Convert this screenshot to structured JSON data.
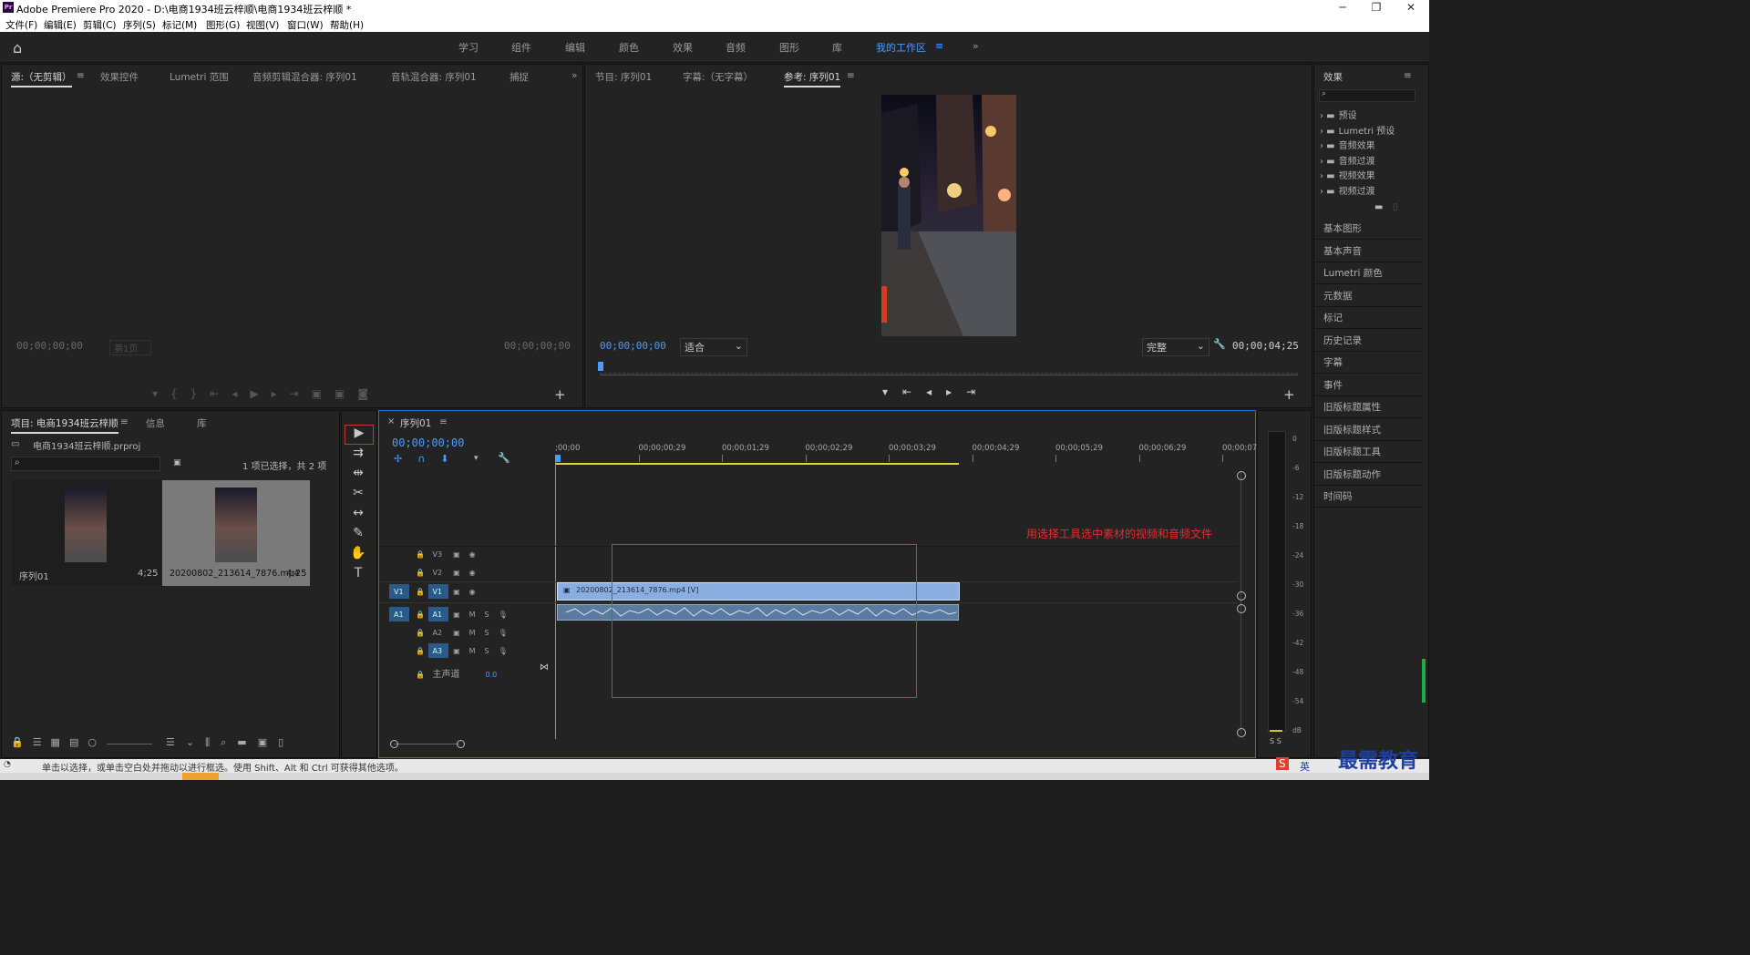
{
  "app": {
    "title": "Adobe Premiere Pro 2020 - D:\\电商1934班云梓顺\\电商1934班云梓顺 *"
  },
  "menu": [
    "文件(F)",
    "编辑(E)",
    "剪辑(C)",
    "序列(S)",
    "标记(M)",
    "图形(G)",
    "视图(V)",
    "窗口(W)",
    "帮助(H)"
  ],
  "workspaces": [
    "学习",
    "组件",
    "编辑",
    "颜色",
    "效果",
    "音频",
    "图形",
    "库",
    "我的工作区"
  ],
  "source_panel": {
    "tabs": [
      "源:（无剪辑）",
      "效果控件",
      "Lumetri 范围",
      "音频剪辑混合器: 序列01",
      "音轨混合器: 序列01",
      "捕捉"
    ],
    "tc_left": "00;00;00;00",
    "page": "第1页",
    "tc_right": "00;00;00;00"
  },
  "program_panel": {
    "tabs": [
      "节目: 序列01",
      "字幕:（无字幕）",
      "参考: 序列01"
    ],
    "tc_left": "00;00;00;00",
    "fit": "适合",
    "quality": "完整",
    "tc_right": "00;00;04;25"
  },
  "effects_panel": {
    "title": "效果",
    "folders": [
      "预设",
      "Lumetri 预设",
      "音频效果",
      "音频过渡",
      "视频效果",
      "视频过渡"
    ],
    "items": [
      "基本图形",
      "基本声音",
      "Lumetri 颜色",
      "元数据",
      "标记",
      "历史记录",
      "字幕",
      "事件",
      "旧版标题属性",
      "旧版标题样式",
      "旧版标题工具",
      "旧版标题动作",
      "时间码"
    ]
  },
  "project_panel": {
    "tabs": [
      "项目: 电商1934班云梓顺",
      "信息",
      "库"
    ],
    "file": "电商1934班云梓顺.prproj",
    "selection": "1 项已选择，共 2 项",
    "items": [
      {
        "name": "序列01",
        "dur": "4;25"
      },
      {
        "name": "20200802_213614_7876.mp4",
        "dur": "4;25"
      }
    ]
  },
  "timeline": {
    "tab": "序列01",
    "tc": "00;00;00;00",
    "ruler": [
      ";00;00",
      "00;00;00;29",
      "00;00;01;29",
      "00;00;02;29",
      "00;00;03;29",
      "00;00;04;29",
      "00;00;05;29",
      "00;00;06;29",
      "00;00;07;"
    ],
    "video_tracks": [
      "V3",
      "V2",
      "V1"
    ],
    "audio_tracks": [
      "A1",
      "A2",
      "A3"
    ],
    "master": "主声道",
    "master_val": "0.0",
    "clip_v": "20200802_213614_7876.mp4 [V]",
    "annotation": "用选择工具选中素材的视频和音频文件"
  },
  "meter": {
    "scale": [
      "0",
      "-6",
      "-12",
      "-18",
      "-24",
      "-30",
      "-36",
      "-42",
      "-48",
      "-54",
      "dB"
    ],
    "labels": "S S"
  },
  "status": {
    "text": "单击以选择，或单击空白处并拖动以进行框选。使用 Shift、Alt 和 Ctrl 可获得其他选项。"
  },
  "watermark": {
    "ime": "英",
    "brand": "最需教育"
  }
}
